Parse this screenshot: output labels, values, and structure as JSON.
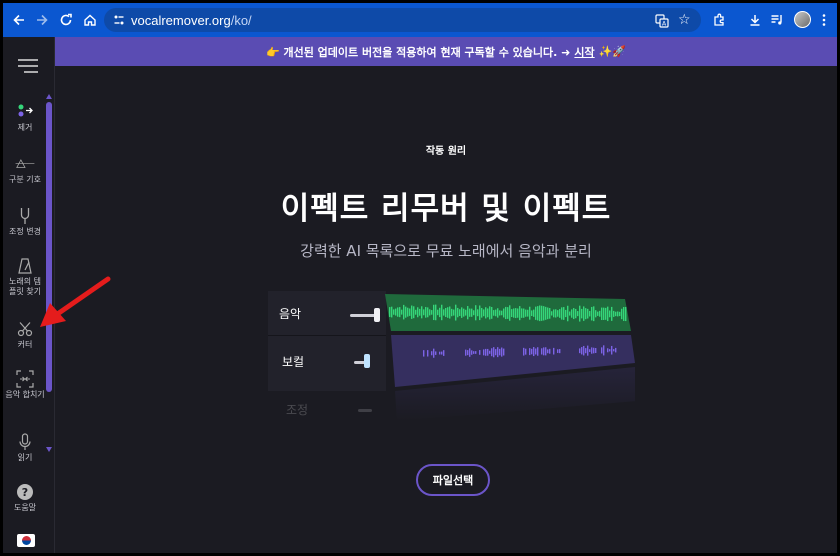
{
  "browser": {
    "url_host": "vocalremover.org",
    "url_path": "/ko/"
  },
  "sidebar": {
    "items": [
      {
        "label": "제거",
        "icon": "dots-arrow-icon"
      },
      {
        "label": "구분 기호",
        "icon": "delta-icon"
      },
      {
        "label": "조정 변경",
        "icon": "tuning-fork-icon"
      },
      {
        "label": "노래의 템 플릿 찾기",
        "icon": "metronome-icon"
      },
      {
        "label": "커터",
        "icon": "scissors-icon"
      },
      {
        "label": "음악 합치기",
        "icon": "merge-icon"
      },
      {
        "label": "읽기",
        "icon": "microphone-icon"
      },
      {
        "label": "도움말",
        "icon": "help-icon"
      }
    ],
    "flag": "korea-flag-icon"
  },
  "banner": {
    "text": "👉 개선된 업데이트 버전을 적용하여 현재 구독할 수 있습니다. ➜",
    "link": "시작",
    "suffix": "✨🚀"
  },
  "hero": {
    "eyebrow": "작동 원리",
    "title": "이펙트 리무버 및 이펙트",
    "subtitle": "강력한 AI 목록으로 무료 노래에서 음악과 분리"
  },
  "mixer": {
    "tracks": [
      {
        "label": "음악"
      },
      {
        "label": "보컬"
      },
      {
        "label": "조정"
      }
    ]
  },
  "cta": {
    "label": "파일선택"
  },
  "colors": {
    "browser_bar": "#0b57d0",
    "banner": "#5a4cb3",
    "accent": "#6b55c9",
    "music_wave": "#35d67a",
    "vocal_wave": "#7c63e6",
    "background": "#1b1b22"
  }
}
